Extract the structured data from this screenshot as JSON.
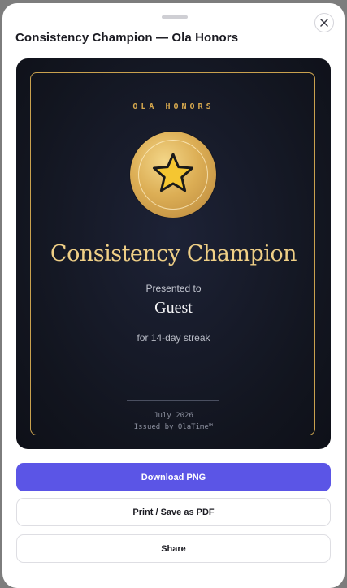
{
  "sheet": {
    "title": "Consistency Champion — Ola Honors",
    "close_icon": "close-icon"
  },
  "certificate": {
    "eyebrow": "OLA HONORS",
    "medal_icon": "star-icon",
    "award_name": "Consistency Champion",
    "presented_label": "Presented to",
    "recipient": "Guest",
    "reason": "for 14-day streak",
    "date": "July 2026",
    "issuer": "Issued by OlaTime™",
    "colors": {
      "background": "#12151f",
      "gold": "#c9a14e",
      "star": "#f5c631"
    }
  },
  "actions": {
    "download": "Download PNG",
    "print": "Print / Save as PDF",
    "share": "Share",
    "primary_color": "#5b55e6"
  }
}
